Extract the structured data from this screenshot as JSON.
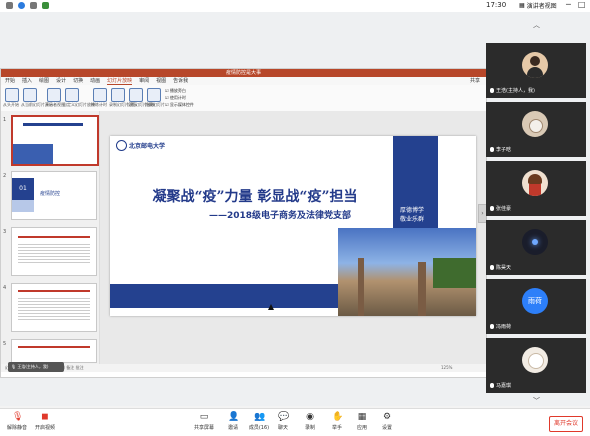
{
  "system": {
    "time": "17:30",
    "view_label": "演讲者视图",
    "controls": [
      "─",
      "□"
    ]
  },
  "ppt": {
    "window_title": "疫情防控是大事",
    "tabs": [
      "开始",
      "插入",
      "绘图",
      "设计",
      "切换",
      "动画",
      "幻灯片放映",
      "审阅",
      "视图",
      "告诉我"
    ],
    "active_tab": "幻灯片放映",
    "share_label": "共享",
    "ribbon_buttons": [
      "从头开始",
      "从当前幻灯片开始",
      "演示者视图",
      "自定义幻灯片放映",
      "排练计时",
      "录制幻灯片演示",
      "设置幻灯片放映",
      "隐藏幻灯片"
    ],
    "ribbon_checks": [
      "播放旁白",
      "使用计时",
      "显示媒体控件"
    ],
    "status_text": "幻灯片第1张，共12张  中文(中国)  备注  批注",
    "zoom": "125%",
    "thumb_numbers": [
      "1",
      "2",
      "3",
      "4",
      "5",
      "6"
    ],
    "thumb_captions": {
      "t2_header": "01",
      "t2_title": "疫情防控"
    }
  },
  "slide": {
    "logo": "北京邮电大学",
    "title": "凝聚战“疫”力量  彰显战“疫”担当",
    "subtitle": "——2018级电子商务及法律党支部",
    "motto_line1": "厚德博学",
    "motto_line2": "敬业乐群"
  },
  "overlay": {
    "muted_text": "王浩(主持人，我)"
  },
  "participants": [
    {
      "name": "王浩(主持人，我)",
      "avatar_icon": "person-photo-icon",
      "bg": "#e6c9a8"
    },
    {
      "name": "李子晗",
      "avatar_icon": "cat-photo-icon",
      "bg": "#d9c9b5"
    },
    {
      "name": "张佳豪",
      "avatar_icon": "cartoon-photo-icon",
      "bg": "#f0e0d0"
    },
    {
      "name": "陈昊天",
      "avatar_icon": "night-photo-icon",
      "bg": "#1a1d2b"
    },
    {
      "name": "冯雨荷",
      "avatar_initials": "雨荷",
      "bg": "#2d7ff9"
    },
    {
      "name": "马嘉琪",
      "avatar_icon": "dog-photo-icon",
      "bg": "#f2ece4"
    }
  ],
  "toolbar": {
    "mute_label": "解除静音",
    "video_label": "开启视频",
    "share_label": "共享屏幕",
    "security_label": "邀请",
    "members_label": "成员(16)",
    "chat_label": "聊天",
    "record_label": "录制",
    "raise_label": "举手",
    "apps_label": "应用",
    "settings_label": "设置",
    "leave_label": "离开会议"
  }
}
